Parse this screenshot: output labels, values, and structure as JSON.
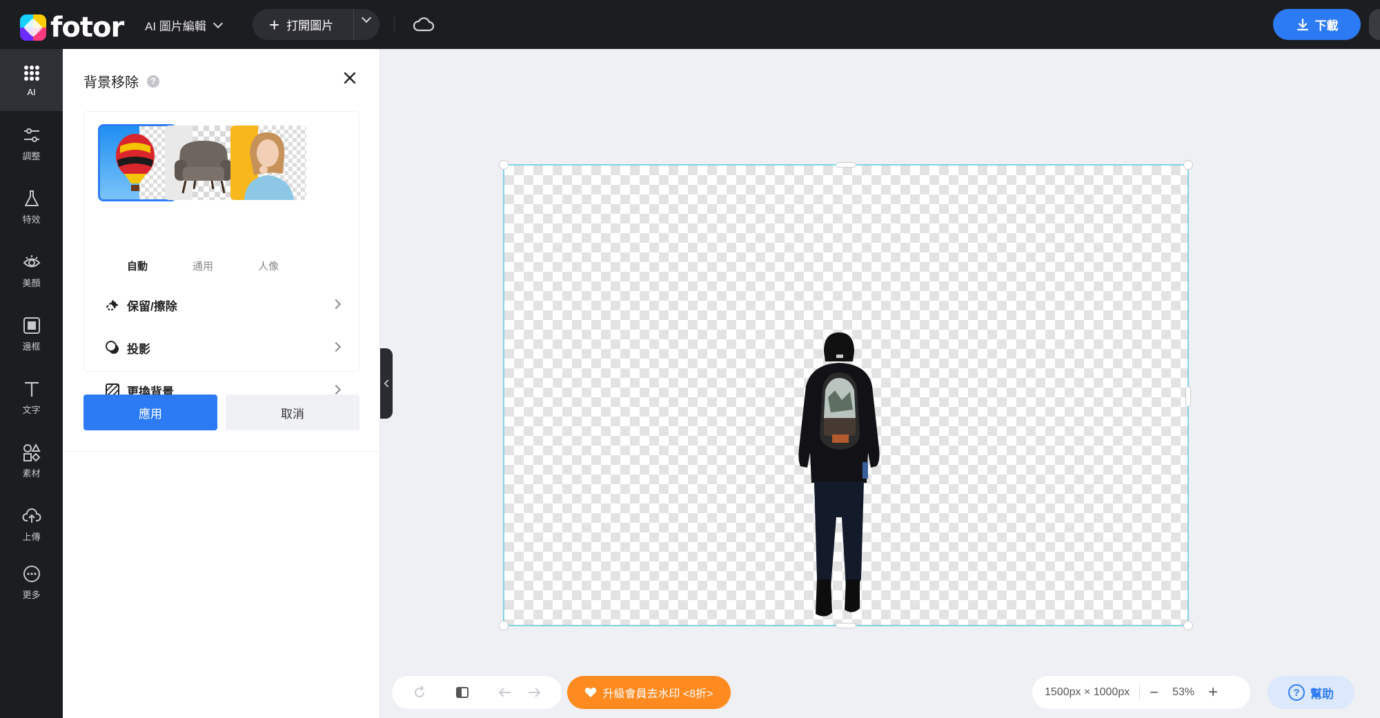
{
  "app": {
    "logo_text": "fotor"
  },
  "topbar": {
    "editor_menu": "AI 圖片編輯",
    "open_image": "打開圖片",
    "download": "下載"
  },
  "rail": [
    {
      "label": "AI",
      "icon": "grid-dots-icon"
    },
    {
      "label": "調整",
      "icon": "sliders-icon"
    },
    {
      "label": "特效",
      "icon": "flask-icon"
    },
    {
      "label": "美顏",
      "icon": "eye-icon"
    },
    {
      "label": "邊框",
      "icon": "frame-icon"
    },
    {
      "label": "文字",
      "icon": "text-icon"
    },
    {
      "label": "素材",
      "icon": "shapes-icon"
    },
    {
      "label": "上傳",
      "icon": "upload-cloud-icon"
    },
    {
      "label": "更多",
      "icon": "more-dots-icon"
    }
  ],
  "panel": {
    "title": "背景移除",
    "help": "?",
    "modes": [
      {
        "label": "自動",
        "selected": true
      },
      {
        "label": "通用",
        "selected": false
      },
      {
        "label": "人像",
        "selected": false
      }
    ],
    "options": [
      {
        "label": "保留/擦除",
        "icon": "eraser-icon"
      },
      {
        "label": "投影",
        "icon": "shadow-icon"
      },
      {
        "label": "更換背景",
        "icon": "background-pattern-icon"
      }
    ],
    "apply": "應用",
    "cancel": "取消"
  },
  "bottom": {
    "upgrade": "升級會員去水印 <8折>",
    "dimensions": "1500px × 1000px",
    "zoom": "53%",
    "minus": "−",
    "plus": "+",
    "help": "幫助"
  },
  "colors": {
    "accent": "#2d7bf4",
    "dark": "#1c1d21",
    "upgrade": "#ff8a1f"
  }
}
